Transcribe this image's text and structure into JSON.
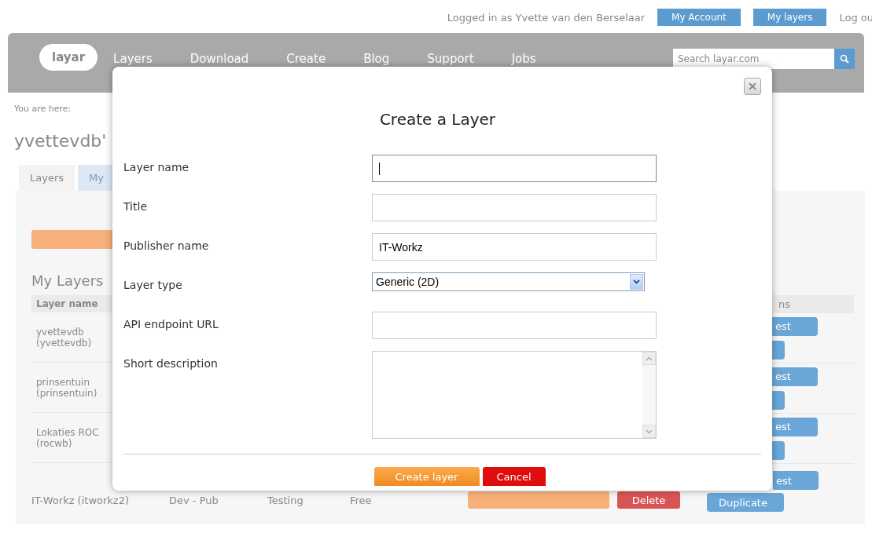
{
  "topbar": {
    "login": "Logged in as Yvette van den Berselaar",
    "links": [
      "My Account",
      "My layers"
    ],
    "logout": "Log ou"
  },
  "nav": {
    "logo": "layar",
    "items": [
      "Layers",
      "Download",
      "Create",
      "Blog",
      "Support",
      "Jobs"
    ],
    "search_placeholder": "Search layar.com"
  },
  "breadcrumb": "You are here:",
  "page_title": "yvettevdb'",
  "tabs": [
    {
      "label": "Layers",
      "selected": true
    },
    {
      "label": "My",
      "selected": false
    }
  ],
  "section_title": "My Layers",
  "table": {
    "columns": [
      "Layer name",
      "ns"
    ],
    "rows": [
      {
        "name": "yvettevdb",
        "sub": "(yvettevdb)",
        "action": "est"
      },
      {
        "name": "prinsentuin",
        "sub": "(prinsentuin)",
        "action": "est"
      },
      {
        "name": "Lokaties ROC",
        "sub": "(rocwb)",
        "action": "est"
      }
    ],
    "last_row": {
      "cells": [
        "IT-Workz (itworkz2)",
        "Dev - Pub",
        "Testing",
        "Free"
      ],
      "delete": "Delete",
      "test": "est",
      "duplicate": "Duplicate"
    }
  },
  "dialog": {
    "title": "Create a Layer",
    "fields": [
      {
        "label": "Layer name",
        "kind": "text",
        "focused": true
      },
      {
        "label": "Title",
        "kind": "text",
        "focused": false
      },
      {
        "label": "Publisher name",
        "kind": "text",
        "value": "IT-Workz",
        "focused": false
      },
      {
        "label": "Layer type",
        "kind": "select",
        "value": "Generic (2D)",
        "focused": false
      },
      {
        "label": "API endpoint URL",
        "kind": "text",
        "focused": false
      },
      {
        "label": "Short description",
        "kind": "textarea",
        "focused": false
      }
    ],
    "buttons": [
      {
        "label": "Create layer",
        "kind": "primary"
      },
      {
        "label": "Cancel",
        "kind": "danger"
      }
    ]
  }
}
